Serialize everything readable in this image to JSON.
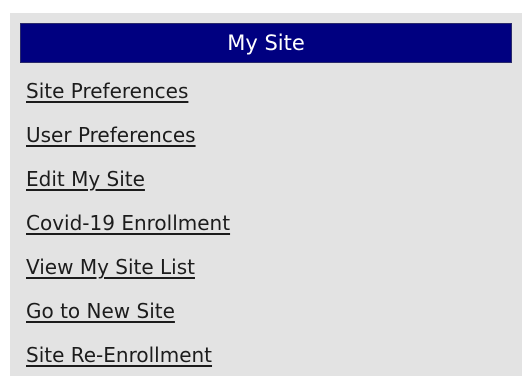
{
  "panel": {
    "title": "My Site",
    "header_color": "#000080",
    "background_color": "#e3e3e3",
    "links": [
      {
        "label": "Site Preferences"
      },
      {
        "label": "User Preferences"
      },
      {
        "label": "Edit My Site"
      },
      {
        "label": "Covid-19 Enrollment"
      },
      {
        "label": "View My Site List"
      },
      {
        "label": "Go to New Site"
      },
      {
        "label": "Site Re-Enrollment"
      }
    ]
  }
}
